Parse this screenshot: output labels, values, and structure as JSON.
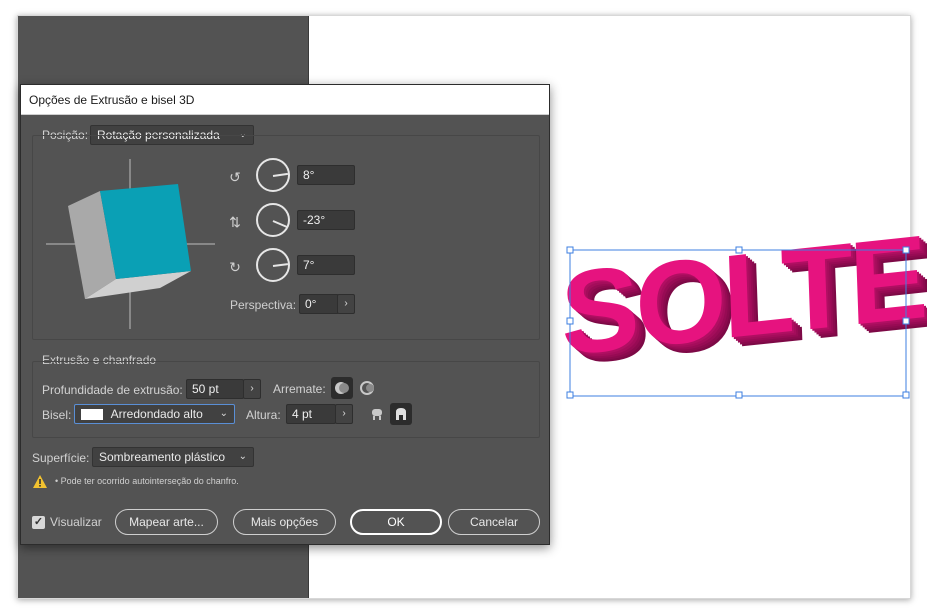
{
  "dialog": {
    "title": "Opções de Extrusão e bisel 3D",
    "position_label": "Posição:",
    "position_value": "Rotação personalizada",
    "rotation": {
      "x_value": "8°",
      "y_value": "-23°",
      "z_value": "7°"
    },
    "perspective_label": "Perspectiva:",
    "perspective_value": "0°",
    "extrusion_section_title": "Extrusão e chanfrado",
    "extrusion_depth_label": "Profundidade de extrusão:",
    "extrusion_depth_value": "50 pt",
    "cap_label": "Arremate:",
    "bevel_label": "Bisel:",
    "bevel_value": "Arredondado alto",
    "height_label": "Altura:",
    "height_value": "4 pt",
    "surface_label": "Superfície:",
    "surface_value": "Sombreamento plástico",
    "warning_text": "• Pode ter ocorrido autointerseção do chanfro.",
    "preview_label": "Visualizar",
    "map_art_button": "Mapear arte...",
    "more_options_button": "Mais opções",
    "ok_button": "OK",
    "cancel_button": "Cancelar"
  },
  "artwork": {
    "text": "SOLTE",
    "color": "#e6137f"
  },
  "colors": {
    "cube_front": "#0aa0b5",
    "cube_side": "#a9a9a9",
    "cube_bottom": "#d0d0d0",
    "selection": "#3d7fe0"
  },
  "icons": {
    "cap_on": "cap-solid-icon",
    "cap_off": "cap-hollow-icon",
    "bevel_out": "bevel-out-icon",
    "bevel_in": "bevel-in-icon"
  }
}
